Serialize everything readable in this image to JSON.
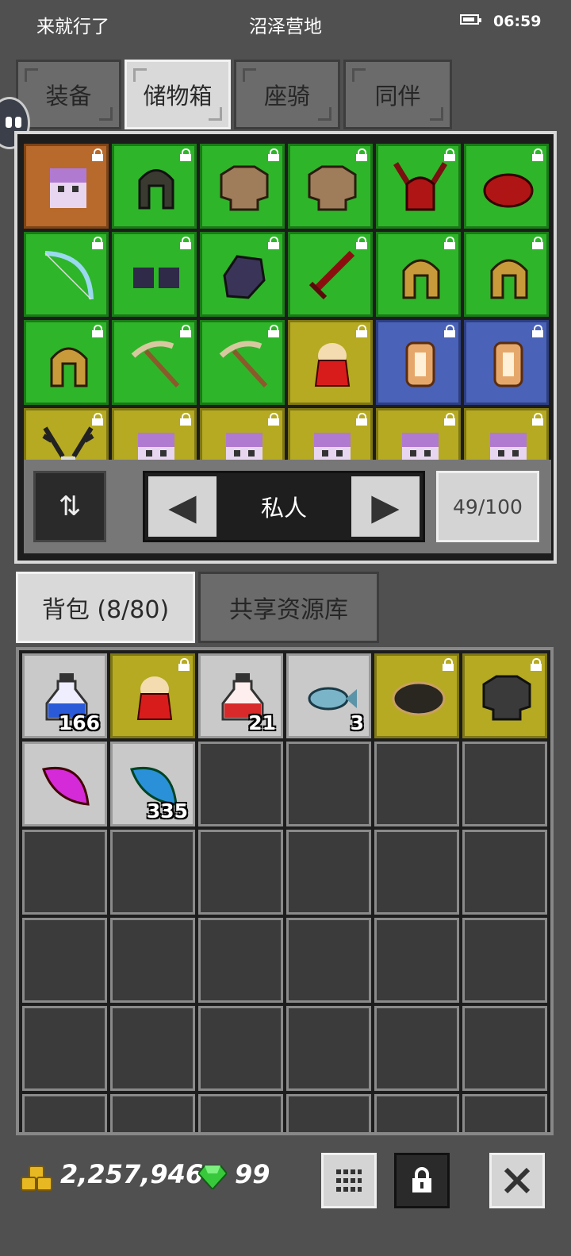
{
  "status_bar": {
    "player_name": "来就行了",
    "location": "沼泽营地",
    "time": "06:59"
  },
  "top_tabs": [
    {
      "label": "装备",
      "active": false
    },
    {
      "label": "储物箱",
      "active": true
    },
    {
      "label": "座骑",
      "active": false
    },
    {
      "label": "同伴",
      "active": false
    }
  ],
  "storage": {
    "page_label": "私人",
    "capacity": "49/100",
    "items": [
      {
        "icon": "portrait-icon",
        "rarity": "orange",
        "locked": true
      },
      {
        "icon": "helmet-icon",
        "rarity": "green",
        "locked": true
      },
      {
        "icon": "chest-armor-icon",
        "rarity": "green",
        "locked": true
      },
      {
        "icon": "chest-armor-icon",
        "rarity": "green",
        "locked": true
      },
      {
        "icon": "horned-helmet-icon",
        "rarity": "green",
        "locked": true
      },
      {
        "icon": "red-cap-icon",
        "rarity": "green",
        "locked": true
      },
      {
        "icon": "bow-icon",
        "rarity": "green",
        "locked": true
      },
      {
        "icon": "dark-boots-icon",
        "rarity": "green",
        "locked": true
      },
      {
        "icon": "gauntlet-icon",
        "rarity": "green",
        "locked": true
      },
      {
        "icon": "red-sword-icon",
        "rarity": "green",
        "locked": true
      },
      {
        "icon": "gold-helmet-icon",
        "rarity": "green",
        "locked": true
      },
      {
        "icon": "gold-helmet-icon",
        "rarity": "green",
        "locked": true
      },
      {
        "icon": "gold-helmet-icon",
        "rarity": "green",
        "locked": true
      },
      {
        "icon": "pickaxe-icon",
        "rarity": "green",
        "locked": true
      },
      {
        "icon": "pickaxe-icon",
        "rarity": "green",
        "locked": true
      },
      {
        "icon": "cape-icon",
        "rarity": "yellow",
        "locked": true
      },
      {
        "icon": "ring-icon",
        "rarity": "blue",
        "locked": true
      },
      {
        "icon": "ring-icon",
        "rarity": "blue",
        "locked": true
      },
      {
        "icon": "antler-icon",
        "rarity": "yellow",
        "locked": true
      },
      {
        "icon": "portrait-icon",
        "rarity": "yellow",
        "locked": true
      },
      {
        "icon": "portrait-icon",
        "rarity": "yellow",
        "locked": true
      },
      {
        "icon": "portrait-icon",
        "rarity": "yellow",
        "locked": true
      },
      {
        "icon": "portrait-icon",
        "rarity": "yellow",
        "locked": true
      },
      {
        "icon": "portrait-icon",
        "rarity": "yellow",
        "locked": true
      }
    ]
  },
  "bag_tabs": [
    {
      "label": "背包 (8/80)",
      "active": true
    },
    {
      "label": "共享资源库",
      "active": false
    }
  ],
  "bag": {
    "items": [
      {
        "icon": "blue-potion-icon",
        "rarity": "gray",
        "locked": false,
        "count": "166"
      },
      {
        "icon": "cape-icon",
        "rarity": "yellow",
        "locked": true,
        "count": ""
      },
      {
        "icon": "red-potion-icon",
        "rarity": "gray",
        "locked": false,
        "count": "21"
      },
      {
        "icon": "fish-icon",
        "rarity": "gray",
        "locked": false,
        "count": "3"
      },
      {
        "icon": "dark-belt-icon",
        "rarity": "yellow",
        "locked": true,
        "count": ""
      },
      {
        "icon": "dark-chest-armor-icon",
        "rarity": "yellow",
        "locked": true,
        "count": ""
      },
      {
        "icon": "purple-leaf-icon",
        "rarity": "gray",
        "locked": false,
        "count": ""
      },
      {
        "icon": "blue-leaf-icon",
        "rarity": "gray",
        "locked": false,
        "count": "335"
      }
    ],
    "empty_slots": 28
  },
  "currency": {
    "gold": "2,257,946",
    "gems": "99"
  },
  "colors": {
    "green": "#2fb52a",
    "orange": "#b8692c",
    "yellow": "#b5aa22",
    "blue": "#4a62b8",
    "gray": "#c9c9c9",
    "empty": "#3b3b3b",
    "gold": "#e8b823",
    "gem": "#38c83c"
  }
}
